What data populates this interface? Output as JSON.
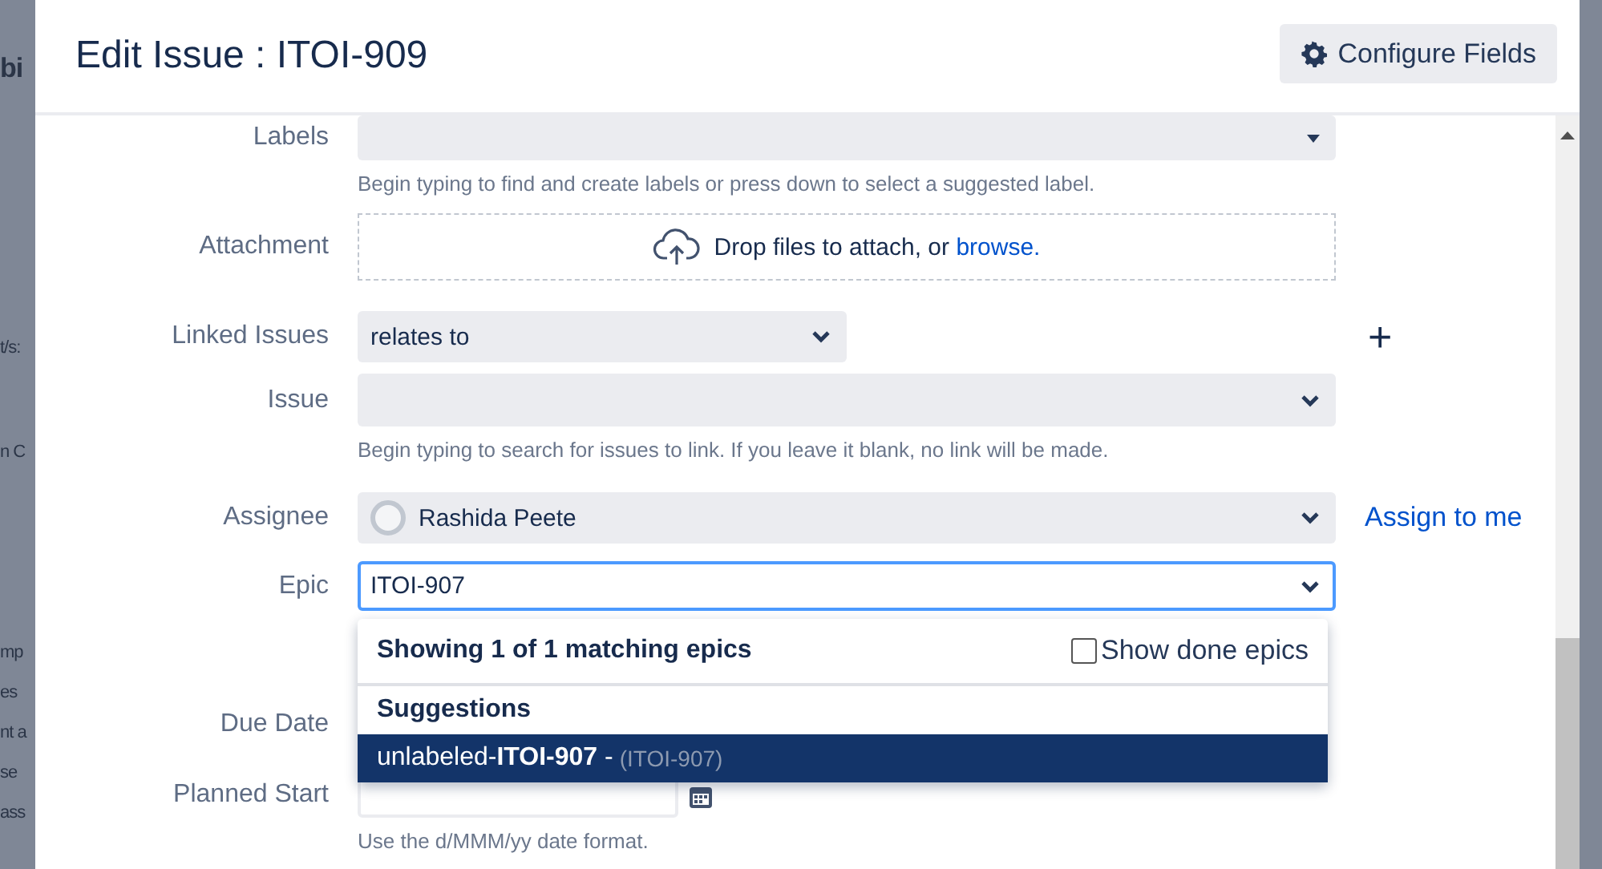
{
  "background": {
    "fragments": [
      "bi",
      "t/s:",
      "n C",
      "mp",
      "es",
      "nt a",
      "se",
      "ass"
    ]
  },
  "dialog": {
    "title": "Edit Issue : ITOI-909",
    "configure_button": "Configure Fields"
  },
  "fields": [
    {
      "kind": "select",
      "label": "Labels",
      "hint": "Begin typing to find and create labels or press down to select a suggested label."
    },
    {
      "kind": "attachment",
      "label": "Attachment",
      "text": "Drop files to attach, or ",
      "link": "browse."
    },
    {
      "kind": "link-type",
      "label": "Linked Issues",
      "value": "relates to",
      "action": "+"
    },
    {
      "kind": "select",
      "label": "Issue",
      "hint": "Begin typing to search for issues to link. If you leave it blank, no link will be made."
    },
    {
      "kind": "user-select",
      "label": "Assignee",
      "value": "Rashida Peete",
      "action": "Assign to me"
    },
    {
      "kind": "epic",
      "label": "Epic",
      "value": "ITOI-907"
    },
    {
      "kind": "covered",
      "label": "Due Date"
    },
    {
      "kind": "date",
      "label": "Planned Start",
      "hint": "Use the d/MMM/yy date format."
    }
  ],
  "epic_dropdown": {
    "header": "Showing 1 of 1 matching epics",
    "show_done": {
      "label": "Show done epics",
      "checked": false
    },
    "section": "Suggestions",
    "items": [
      {
        "label": "unlabeled-**ITOI-907** - ",
        "key": "(ITOI-907)",
        "selected": true
      }
    ]
  }
}
